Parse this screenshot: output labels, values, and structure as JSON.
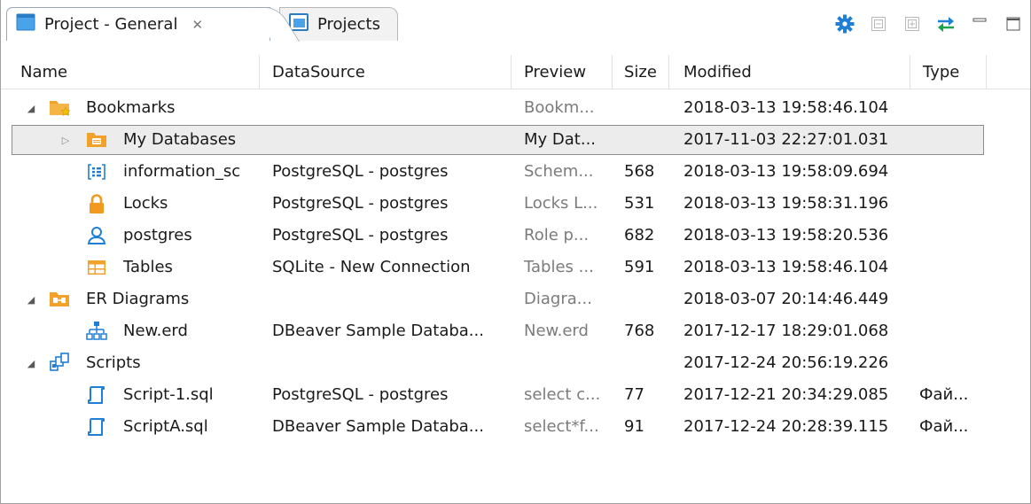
{
  "tabs": [
    {
      "label": "Project - General",
      "active": true,
      "icon": "project-icon"
    },
    {
      "label": "Projects",
      "active": false,
      "icon": "projects-icon"
    }
  ],
  "toolbar": {
    "icons": [
      "gear-icon",
      "collapse-all-icon",
      "expand-all-icon",
      "link-with-editor-icon",
      "minimize-icon",
      "maximize-icon"
    ]
  },
  "columns": {
    "name": "Name",
    "datasource": "DataSource",
    "preview": "Preview",
    "size": "Size",
    "modified": "Modified",
    "type": "Type"
  },
  "rows": [
    {
      "level": 0,
      "expander": "expanded",
      "icon": "bookmarks-folder-icon",
      "name": "Bookmarks",
      "datasource": "",
      "preview": "Bookm...",
      "size": "",
      "modified": "2018-03-13 19:58:46.104",
      "type": ""
    },
    {
      "level": 1,
      "expander": "collapsed",
      "icon": "database-folder-icon",
      "name": "My Databases",
      "datasource": "",
      "preview": "My Dat...",
      "size": "",
      "modified": "2017-11-03 22:27:01.031",
      "type": "",
      "selected": true
    },
    {
      "level": 1,
      "expander": "none",
      "icon": "schema-icon",
      "name": "information_sc",
      "datasource": "PostgreSQL - postgres",
      "preview": "Schem...",
      "size": "568",
      "modified": "2018-03-13 19:58:09.694",
      "type": ""
    },
    {
      "level": 1,
      "expander": "none",
      "icon": "lock-icon",
      "name": "Locks",
      "datasource": "PostgreSQL - postgres",
      "preview": "Locks L...",
      "size": "531",
      "modified": "2018-03-13 19:58:31.196",
      "type": ""
    },
    {
      "level": 1,
      "expander": "none",
      "icon": "user-icon",
      "name": "postgres",
      "datasource": "PostgreSQL - postgres",
      "preview": "Role p...",
      "size": "682",
      "modified": "2018-03-13 19:58:20.536",
      "type": ""
    },
    {
      "level": 1,
      "expander": "none",
      "icon": "table-icon",
      "name": "Tables",
      "datasource": "SQLite - New Connection",
      "preview": "Tables ...",
      "size": "591",
      "modified": "2018-03-13 19:58:46.104",
      "type": ""
    },
    {
      "level": 0,
      "expander": "expanded",
      "icon": "er-folder-icon",
      "name": "ER Diagrams",
      "datasource": "",
      "preview": "Diagra...",
      "size": "",
      "modified": "2018-03-07 20:14:46.449",
      "type": ""
    },
    {
      "level": 1,
      "expander": "none",
      "icon": "er-diagram-icon",
      "name": "New.erd",
      "datasource": "DBeaver Sample Databa...",
      "preview": "New.erd",
      "size": "768",
      "modified": "2017-12-17 18:29:01.068",
      "type": ""
    },
    {
      "level": 0,
      "expander": "expanded",
      "icon": "scripts-folder-icon",
      "name": "Scripts",
      "datasource": "",
      "preview": "",
      "size": "",
      "modified": "2017-12-24 20:56:19.226",
      "type": ""
    },
    {
      "level": 1,
      "expander": "none",
      "icon": "sql-script-icon",
      "name": "Script-1.sql",
      "datasource": "PostgreSQL - postgres",
      "preview": "select c...",
      "size": "77",
      "modified": "2017-12-21 20:34:29.085",
      "type": "Фай..."
    },
    {
      "level": 1,
      "expander": "none",
      "icon": "sql-script-icon",
      "name": "ScriptA.sql",
      "datasource": "DBeaver Sample Databa...",
      "preview": "select*f...",
      "size": "91",
      "modified": "2017-12-24 20:28:39.115",
      "type": "Фай..."
    }
  ],
  "colors": {
    "accent_blue": "#1f7fd6",
    "folder_orange": "#f2a12b",
    "selection_bg": "#ececec",
    "selection_border": "#8d8d8d",
    "link_green": "#1aa34a"
  }
}
